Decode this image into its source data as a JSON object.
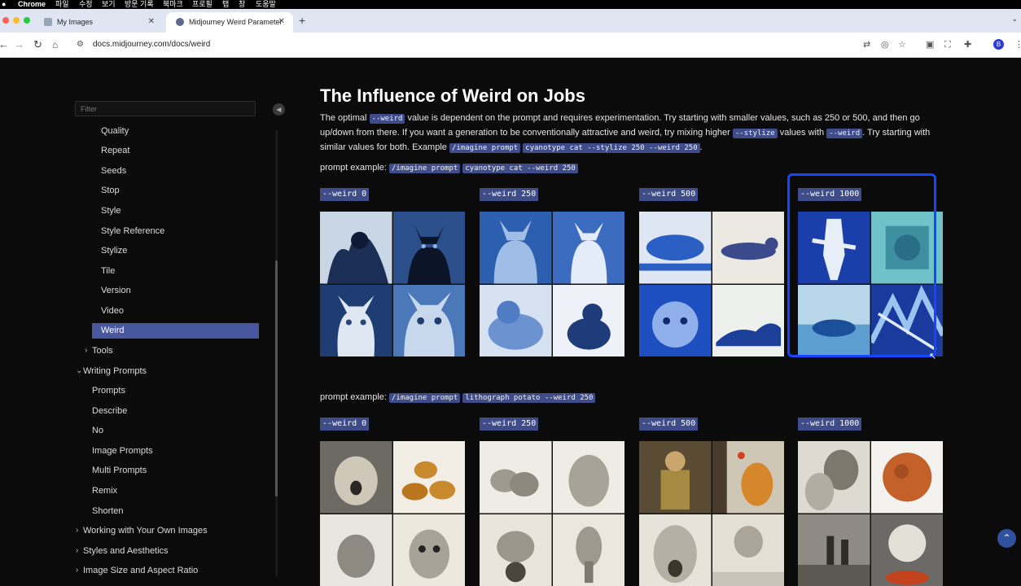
{
  "menubar": {
    "app": "Chrome",
    "items": [
      "파일",
      "수정",
      "보기",
      "방문 기록",
      "북마크",
      "프로필",
      "탭",
      "창",
      "도움말"
    ]
  },
  "browser": {
    "tabs": [
      {
        "label": "My Images",
        "active": false
      },
      {
        "label": "Midjourney Weird Parameter",
        "active": true
      }
    ],
    "url": "docs.midjourney.com/docs/weird",
    "profile_initial": "B"
  },
  "sidebar": {
    "filter_placeholder": "Filter",
    "items": [
      {
        "label": "Quality",
        "level": 2
      },
      {
        "label": "Repeat",
        "level": 2
      },
      {
        "label": "Seeds",
        "level": 2
      },
      {
        "label": "Stop",
        "level": 2
      },
      {
        "label": "Style",
        "level": 2
      },
      {
        "label": "Style Reference",
        "level": 2
      },
      {
        "label": "Stylize",
        "level": 2
      },
      {
        "label": "Tile",
        "level": 2
      },
      {
        "label": "Version",
        "level": 2
      },
      {
        "label": "Video",
        "level": 2
      },
      {
        "label": "Weird",
        "level": 2,
        "active": true
      },
      {
        "label": "Tools",
        "level": 1,
        "expanded": false
      },
      {
        "label": "Writing Prompts",
        "level": 0,
        "expanded": true
      },
      {
        "label": "Prompts",
        "level": 1
      },
      {
        "label": "Describe",
        "level": 1
      },
      {
        "label": "No",
        "level": 1
      },
      {
        "label": "Image Prompts",
        "level": 1
      },
      {
        "label": "Multi Prompts",
        "level": 1
      },
      {
        "label": "Remix",
        "level": 1
      },
      {
        "label": "Shorten",
        "level": 1
      },
      {
        "label": "Working with Your Own Images",
        "level": 0,
        "expanded": false
      },
      {
        "label": "Styles and Aesthetics",
        "level": 0,
        "expanded": false
      },
      {
        "label": "Image Size and Aspect Ratio",
        "level": 0,
        "expanded": false
      }
    ]
  },
  "main": {
    "title": "The Influence of Weird on Jobs",
    "para": {
      "t1": "The optimal ",
      "c1": "--weird",
      "t2": " value is dependent on the prompt and requires experimentation. Try starting with smaller values, such as 250 or 500, and then go up/down from there. If you want a generation to be conventionally attractive and weird, try mixing higher ",
      "c2": "--stylize",
      "t3": " values with ",
      "c3": "--weird",
      "t4": ". Try starting with similar values for both. Example ",
      "c4": "/imagine prompt",
      "t5": " ",
      "c5": "cyanotype cat --stylize 250 --weird 250",
      "t6": "."
    },
    "example1": {
      "label": "prompt example: ",
      "cmd": "/imagine prompt",
      "arg": "cyanotype cat --weird 250"
    },
    "example2": {
      "label": "prompt example: ",
      "cmd": "/imagine prompt",
      "arg": "lithograph potato --weird 250"
    },
    "weird_labels": [
      "--weird 0",
      "--weird 250",
      "--weird 500",
      "--weird 1000"
    ],
    "row1_images": [
      [
        "dark-cat-cyanotype",
        "black-cat-cyanotype",
        "white-cat-cyanotype",
        "fluffy-cat-cyanotype"
      ],
      [
        "cat-portrait-cyanotype",
        "white-cat-cyanotype",
        "tabby-cat-cyanotype",
        "sitting-cat-cyanotype"
      ],
      [
        "lying-cat-cyanotype",
        "stretching-cat-sketch",
        "cat-face-cyanotype",
        "cat-silhouette-cyanotype"
      ],
      [
        "abstract-cat-cyanotype",
        "teal-face-cyanotype",
        "cat-landscape-cyanotype",
        "fractured-cat-cyanotype"
      ]
    ],
    "row2_images": [
      [
        "screaming-potato-man",
        "potato-pile",
        "potato-on-table",
        "potato-creature"
      ],
      [
        "potato-heap",
        "single-potato",
        "potato-head-child",
        "potato-tower"
      ],
      [
        "potato-clown",
        "orange-potato-beach",
        "screaming-face-sculpture",
        "floating-potato"
      ],
      [
        "old-woman-potato",
        "red-planet-potato",
        "farm-figures",
        "potato-landscape"
      ]
    ]
  },
  "colors": {
    "accent": "#48589f",
    "code_bg": "#3e4d8a",
    "highlight": "#1746ff",
    "page_bg": "#0b0b0b"
  }
}
